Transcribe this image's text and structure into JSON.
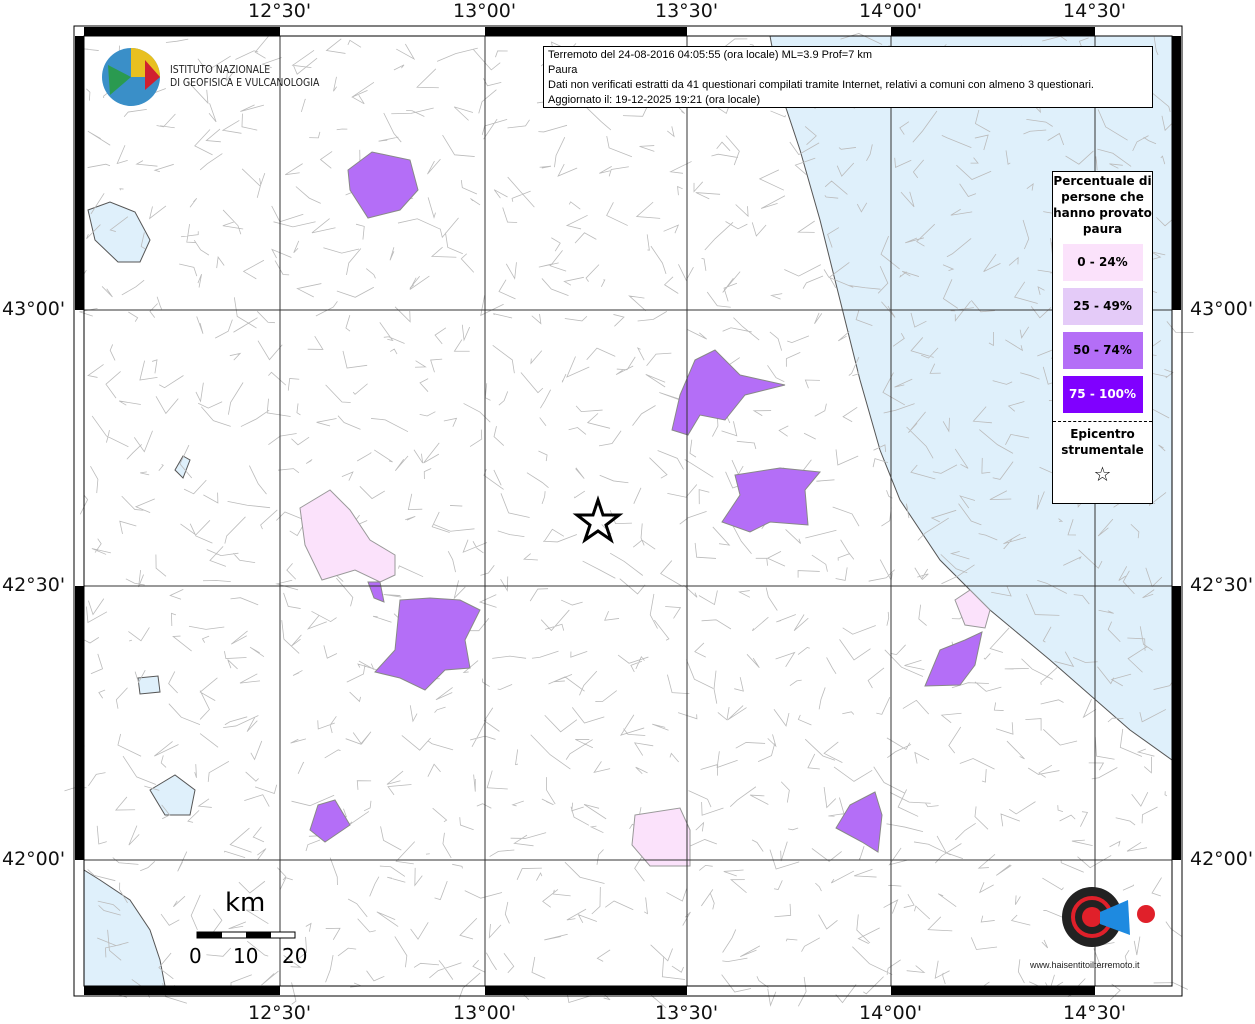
{
  "axes": {
    "lon_labels": [
      "12°30'",
      "13°00'",
      "13°30'",
      "14°00'",
      "14°30'"
    ],
    "lat_labels": [
      "43°00'",
      "42°30'",
      "42°00'"
    ]
  },
  "info": {
    "line1": "Terremoto del 24-08-2016 04:05:55 (ora locale) ML=3.9 Prof=7 km",
    "line2": "Paura",
    "line3": "Dati non verificati estratti da 41 questionari compilati tramite Internet, relativi a comuni con almeno 3 questionari.",
    "line4": "Aggiornato il: 19-12-2025 19:21 (ora locale)"
  },
  "legend": {
    "title": "Percentuale di persone che hanno provato paura",
    "classes": [
      {
        "label": "0 - 24%",
        "color": "#fbe2fb"
      },
      {
        "label": "25 - 49%",
        "color": "#e4cbf8"
      },
      {
        "label": "50 - 74%",
        "color": "#b46ef7"
      },
      {
        "label": "75 - 100%",
        "color": "#8000ff"
      }
    ],
    "epicenter_label": "Epicentro strumentale",
    "epicenter_symbol": "☆"
  },
  "logo_ingv": {
    "line1": "ISTITUTO NAZIONALE",
    "line2": "DI GEOFISICA E VULCANOLOGIA"
  },
  "logo_hst": "www.haisentitoilterremoto.it",
  "scale": {
    "unit": "km",
    "ticks": [
      "0",
      "10",
      "20"
    ]
  },
  "colors": {
    "sea": "#dff0fb",
    "border": "#aaaaaa"
  }
}
